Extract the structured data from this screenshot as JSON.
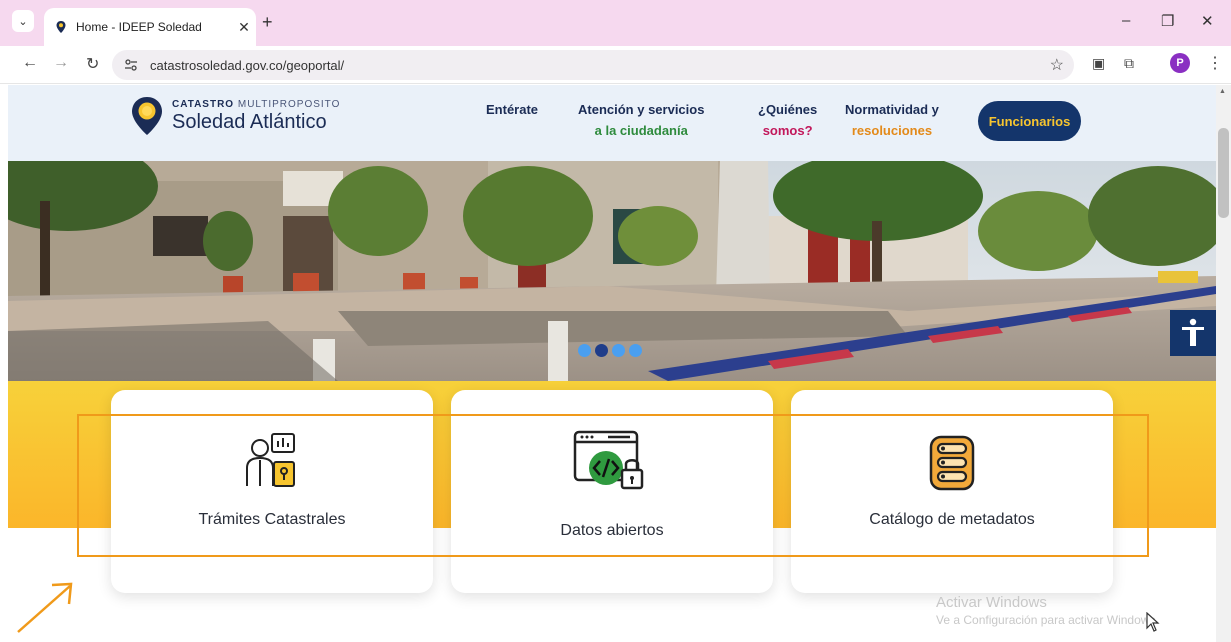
{
  "browser": {
    "tab_title": "Home - IDEEP Soledad",
    "tab_close": "✕",
    "new_tab": "+",
    "url": "catastrosoledad.gov.co/geoportal/",
    "profile_initial": "P",
    "window_min": "–",
    "window_restore": "❐",
    "window_close": "✕"
  },
  "header": {
    "logo_top_bold": "CATASTRO",
    "logo_top_rest": "MULTIPROPOSITO",
    "logo_main": "Soledad Atlántico",
    "menu": [
      {
        "line1": "Entérate",
        "line2": ""
      },
      {
        "line1": "Atención y servicios",
        "line2": "a la ciudadanía"
      },
      {
        "line1": "¿Quiénes",
        "line2": "somos?"
      },
      {
        "line1": "Normatividad y",
        "line2": "resoluciones"
      }
    ],
    "button": "Funcionarios"
  },
  "cards": [
    {
      "label": "Trámites Catastrales",
      "icon": "person-document-icon"
    },
    {
      "label": "Datos abiertos",
      "icon": "code-lock-icon"
    },
    {
      "label": "Catálogo de metadatos",
      "icon": "database-catalog-icon"
    }
  ],
  "watermark": {
    "line1": "Activar Windows",
    "line2": "Ve a Configuración para activar Windows."
  },
  "colors": {
    "brand_navy": "#14356b",
    "accent_yellow": "#f7c52f",
    "highlight_orange": "#f09a1a",
    "tab_bar": "#f6d9ef"
  }
}
